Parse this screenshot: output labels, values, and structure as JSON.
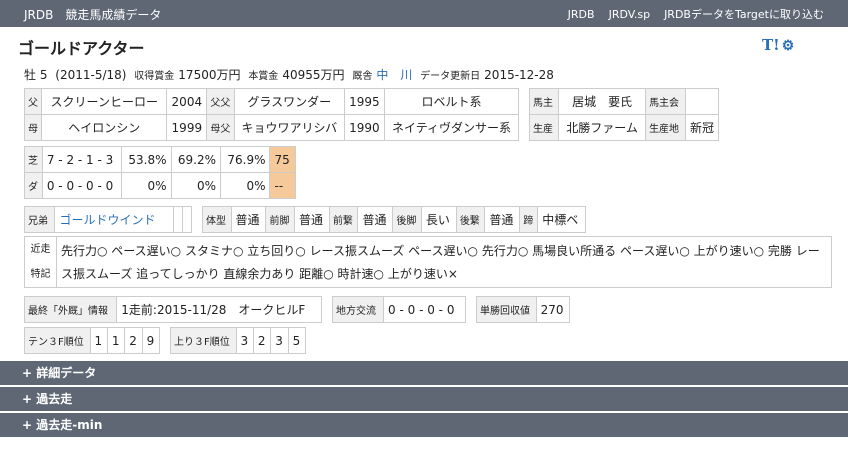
{
  "header": {
    "brand": "JRDB",
    "title": "競走馬成績データ",
    "nav": [
      "JRDB",
      "JRDV.sp",
      "JRDBデータをTargetに取り込む"
    ]
  },
  "horse": {
    "name": "ゴールドアクター",
    "tools_label": "T!",
    "sex_age": "牡 5",
    "birth": "(2011-5/18)",
    "prize_label": "収得賞金",
    "prize": "17500万円",
    "main_prize_label": "本賞金",
    "main_prize": "40955万円",
    "stable_label": "厩舎",
    "stable": "中　川",
    "updated_label": "データ更新日",
    "updated": "2015-12-28"
  },
  "pedigree": {
    "rows": [
      {
        "h1": "父",
        "v1": "スクリーンヒーロー",
        "y1": "2004",
        "h2": "父父",
        "v2": "グラスワンダー",
        "y2": "1995",
        "line": "ロベルト系"
      },
      {
        "h1": "母",
        "v1": "ヘイロンシン",
        "y1": "1999",
        "h2": "母父",
        "v2": "キョウワアリシバ",
        "y2": "1990",
        "line": "ネイティヴダンサー系"
      }
    ]
  },
  "owner": {
    "owner_label": "馬主",
    "owner": "居城　要氏",
    "owner_club_label": "馬主会",
    "owner_club": "",
    "breeder_label": "生産",
    "breeder": "北勝ファーム",
    "area_label": "生産地",
    "area": "新冠"
  },
  "record": {
    "rows": [
      {
        "type": "芝",
        "record": "7 - 2 - 1 - 3",
        "win": "53.8%",
        "top2": "69.2%",
        "top3": "76.9%",
        "idx": "75"
      },
      {
        "type": "ダ",
        "record": "0 - 0 - 0 - 0",
        "win": "0%",
        "top2": "0%",
        "top3": "0%",
        "idx": "--"
      }
    ]
  },
  "siblings": {
    "label": "兄弟",
    "name": "ゴールドウインド"
  },
  "body": [
    {
      "label": "体型",
      "value": "普通"
    },
    {
      "label": "前脚",
      "value": "普通"
    },
    {
      "label": "前繋",
      "value": "普通"
    },
    {
      "label": "後脚",
      "value": "長い"
    },
    {
      "label": "後繋",
      "value": "普通"
    },
    {
      "label": "蹄",
      "value": "中標ベ"
    }
  ],
  "tokki": {
    "label1": "近走",
    "label2": "特記",
    "text": "先行力○ ペース遅い○ スタミナ○ 立ち回り○ レース振スムーズ ペース遅い○ 先行力○ 馬場良い所通る ペース遅い○ 上がり速い○ 完勝 レース振スムーズ 追ってしっかり 直線余力あり 距離○ 時計速○ 上がり速い×"
  },
  "latest": {
    "label": "最終「外厩」情報",
    "value": "1走前:2015-11/28　オークヒルF",
    "local_label": "地方交流",
    "local_value": "0 - 0 - 0 - 0",
    "recovery_label": "単勝回収値",
    "recovery_value": "270"
  },
  "ranks": {
    "ten_label": "テン３F順位",
    "ten": [
      "1",
      "1",
      "2",
      "9"
    ],
    "agari_label": "上り３F順位",
    "agari": [
      "3",
      "2",
      "3",
      "5"
    ]
  },
  "sections": [
    "+ 詳細データ",
    "+ 過去走",
    "+ 過去走-min"
  ]
}
